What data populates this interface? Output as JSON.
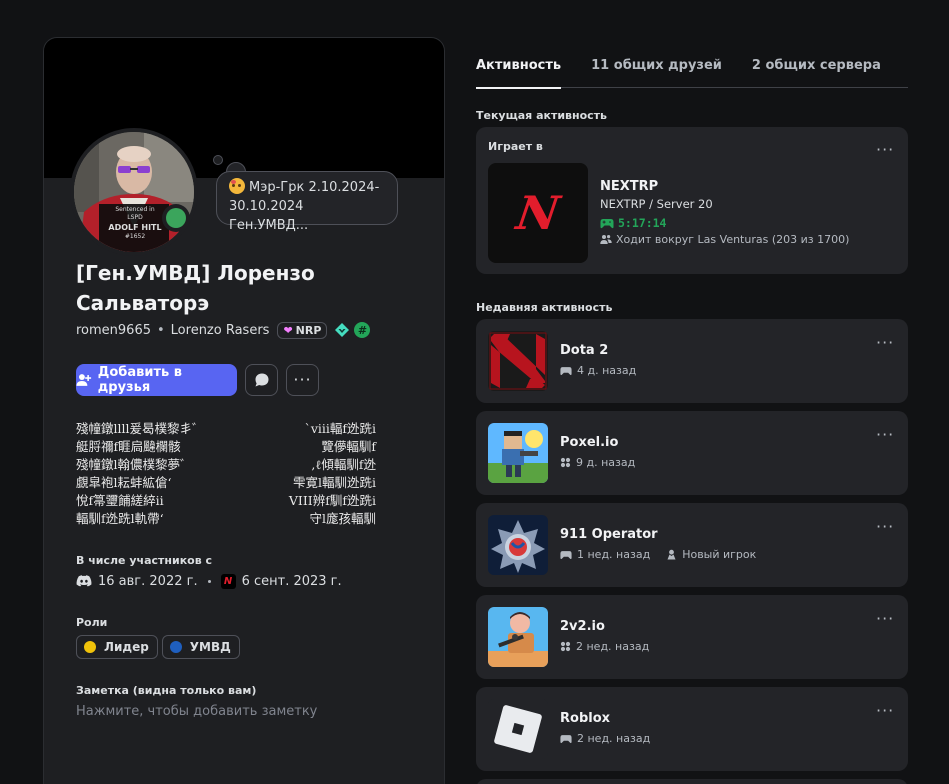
{
  "profile": {
    "status_text": "Мэр-Грк 2.10.2024-30.10.2024 Ген.УМВД...",
    "display_name": "[Ген.УМВД] Лорензо Сальваторэ",
    "username": "romen9665",
    "pronouns": "Lorenzo Rasers",
    "server_tag": "NRP",
    "add_friend_label": "Добавить в друзья",
    "avatar_text_1": "Sentenced in",
    "avatar_text_2": "LSPD",
    "avatar_text_3": "ADOLF HITL",
    "avatar_text_4": "#1652",
    "bio_rows": [
      [
        "殘幢鐓llll爰曷樸黎丯゛",
        "`viii輻f迯跣i"
      ],
      [
        "艇脟禰f睚扃颹欄骸",
        "覽儚輻馴f"
      ],
      [
        "殘幢鐓l翰儂樸黎夢゛",
        ",ℓ傾輻馴f迯"
      ],
      [
        "覷皐袍l耘蚌絋傖ʻ",
        "雫寛l輻馴迯跣i"
      ],
      [
        "悅f箒瓕餔縒綷ii",
        "VIII辨f馴f迯跣i"
      ],
      [
        "輻馴f迯跣l軌帶ʻ",
        "守l庬孩輻馴"
      ]
    ],
    "member_since_title": "В числе участников с",
    "member_discord_date": "16 авг. 2022 г.",
    "member_server_date": "6 сент. 2023 г.",
    "roles_title": "Роли",
    "roles": [
      {
        "name": "Лидер",
        "color": "#f0c20a"
      },
      {
        "name": "УМВД",
        "color": "#1f5fbf"
      }
    ],
    "note_title": "Заметка (видна только вам)",
    "note_placeholder": "Нажмите, чтобы добавить заметку"
  },
  "tabs": [
    {
      "label": "Активность",
      "active": true
    },
    {
      "label": "11 общих друзей",
      "active": false
    },
    {
      "label": "2 общих сервера",
      "active": false
    }
  ],
  "current_activity": {
    "section_title": "Текущая активность",
    "label": "Играет в",
    "game": "NEXTRP",
    "details": "NEXTRP / Server 20",
    "elapsed": "5:17:14",
    "state": "Ходит вокруг Las Venturas (203 из 1700)"
  },
  "recent_activity": {
    "section_title": "Недавняя активность",
    "items": [
      {
        "name": "Dota 2",
        "time": "4 д. назад",
        "extra": "",
        "icon": "gamepad-icon"
      },
      {
        "name": "Poxel.io",
        "time": "9 д. назад",
        "extra": "",
        "icon": "apps-icon"
      },
      {
        "name": "911 Operator",
        "time": "1 нед. назад",
        "extra": "Новый игрок",
        "icon": "gamepad-icon"
      },
      {
        "name": "2v2.io",
        "time": "2 нед. назад",
        "extra": "",
        "icon": "apps-icon"
      },
      {
        "name": "Roblox",
        "time": "2 нед. назад",
        "extra": "",
        "icon": "gamepad-icon"
      }
    ]
  },
  "colors": {
    "accent": "#5865f2",
    "online": "#3ba55c",
    "playing": "#23a559"
  }
}
